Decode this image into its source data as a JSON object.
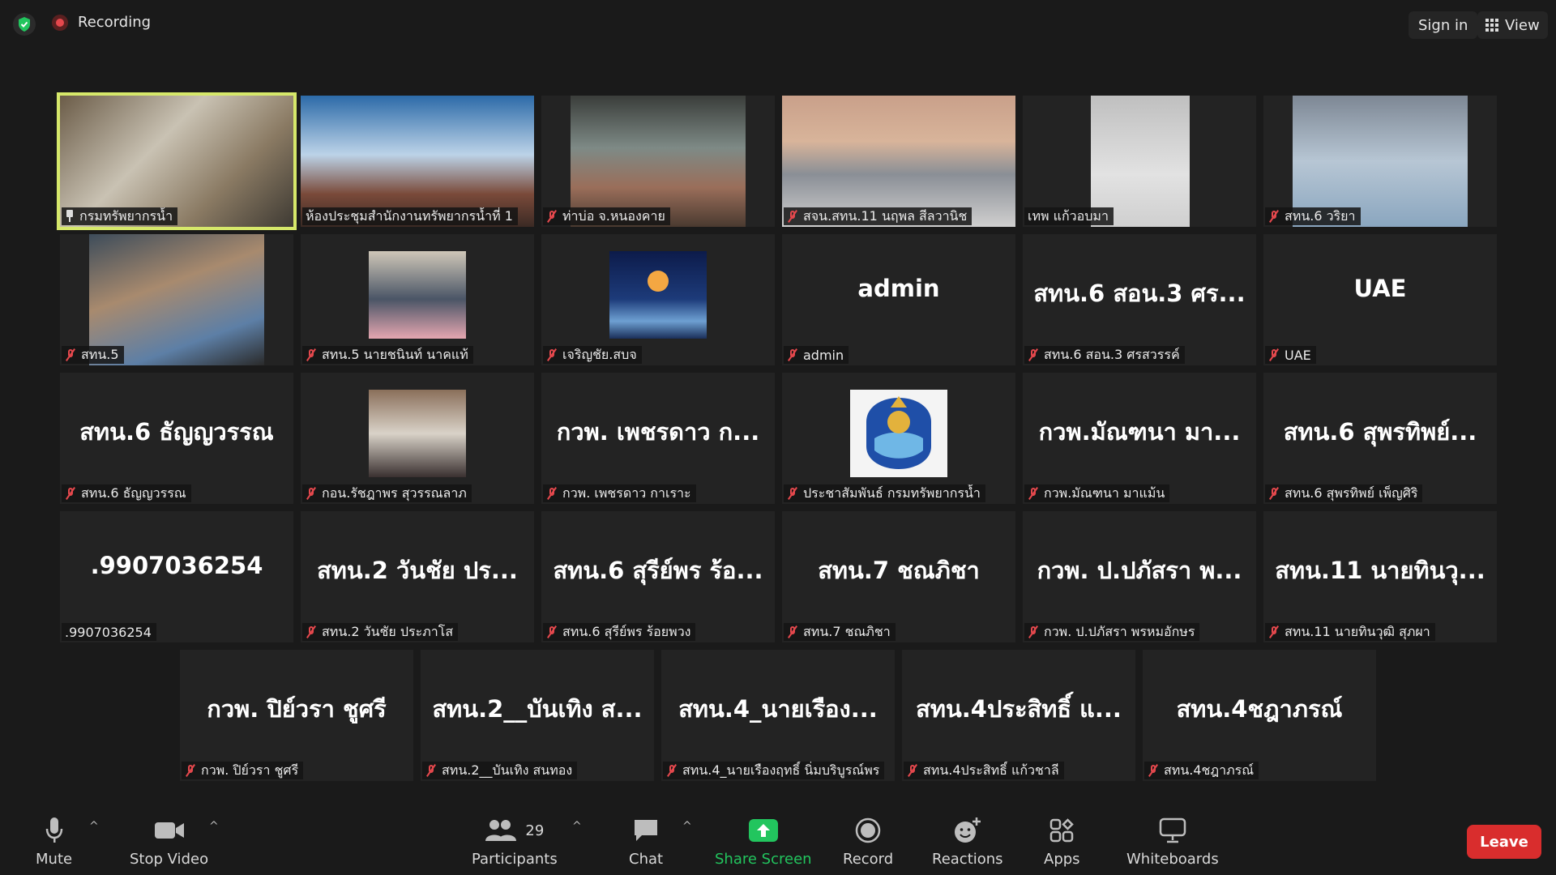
{
  "top": {
    "recording_label": "Recording",
    "sign_in": "Sign in",
    "view": "View"
  },
  "tiles": [
    {
      "label": "กรมทรัพยากรน้ำ",
      "big": "",
      "muted": false,
      "pinned": true
    },
    {
      "label": "ห้องประชุมสำนักงานทรัพยากรน้ำที่ 1",
      "big": "",
      "muted": false
    },
    {
      "label": "ท่าบ่อ จ.หนองคาย",
      "big": "",
      "muted": true
    },
    {
      "label": "สจน.สทน.11 นฤพล สีลวานิช",
      "big": "",
      "muted": true
    },
    {
      "label": "เทพ แก้วอบมา",
      "big": "",
      "muted": false
    },
    {
      "label": "สทน.6 วริยา",
      "big": "",
      "muted": true
    },
    {
      "label": "สทน.5",
      "big": "",
      "muted": true
    },
    {
      "label": "สทน.5 นายชนินท์ นาคแท้",
      "big": "",
      "muted": true
    },
    {
      "label": "เจริญชัย.สบจ",
      "big": "",
      "muted": true
    },
    {
      "label": "admin",
      "big": "admin",
      "muted": true
    },
    {
      "label": "สทน.6 สอน.3 ศรสวรรค์",
      "big": "สทน.6 สอน.3 ศร...",
      "muted": true
    },
    {
      "label": "UAE",
      "big": "UAE",
      "muted": true
    },
    {
      "label": "สทน.6 ธัญญวรรณ",
      "big": "สทน.6 ธัญญวรรณ",
      "muted": true
    },
    {
      "label": "กอน.รัชฎาพร สุวรรณลาภ",
      "big": "",
      "muted": true
    },
    {
      "label": "กวพ. เพชรดาว กาเราะ",
      "big": "กวพ. เพชรดาว ก...",
      "muted": true
    },
    {
      "label": "ประชาสัมพันธ์ กรมทรัพยากรน้ำ",
      "big": "",
      "muted": true
    },
    {
      "label": "กวพ.มัณฑนา มาแม้น",
      "big": "กวพ.มัณฑนา มา...",
      "muted": true
    },
    {
      "label": "สทน.6 สุพรทิพย์ เพ็ญศิริ",
      "big": "สทน.6 สุพรทิพย์...",
      "muted": true
    },
    {
      "label": ".9907036254",
      "big": ".9907036254",
      "muted": false
    },
    {
      "label": "สทน.2 วันชัย ประภาโส",
      "big": "สทน.2 วันชัย ปร...",
      "muted": true
    },
    {
      "label": "สทน.6 สุรีย์พร ร้อยพวง",
      "big": "สทน.6 สุรีย์พร ร้อ...",
      "muted": true
    },
    {
      "label": "สทน.7 ชณภิชา",
      "big": "สทน.7 ชณภิชา",
      "muted": true
    },
    {
      "label": "กวพ. ป.ปภัสรา พรหมอักษร",
      "big": "กวพ. ป.ปภัสรา พ...",
      "muted": true
    },
    {
      "label": "สทน.11 นายทินวุฒิ สุภผา",
      "big": "สทน.11 นายทินวุ...",
      "muted": true
    },
    {
      "label": "กวพ. ปิย์วรา ชูศรี",
      "big": "กวพ. ปิย์วรา ชูศรี",
      "muted": true
    },
    {
      "label": "สทน.2__บันเทิง สนทอง",
      "big": "สทน.2__บันเทิง ส...",
      "muted": true
    },
    {
      "label": "สทน.4_นายเรืองฤทธิ์ นิ่มบริบูรณ์พร",
      "big": "สทน.4_นายเรือง...",
      "muted": true
    },
    {
      "label": "สทน.4ประสิทธิ์ แก้วชาลี",
      "big": "สทน.4ประสิทธิ์ แ...",
      "muted": true
    },
    {
      "label": "สทน.4ชฎาภรณ์",
      "big": "สทน.4ชฎาภรณ์",
      "muted": true
    }
  ],
  "toolbar": {
    "mute": "Mute",
    "stop_video": "Stop Video",
    "participants": "Participants",
    "participants_count": "29",
    "chat": "Chat",
    "share_screen": "Share Screen",
    "record": "Record",
    "reactions": "Reactions",
    "apps": "Apps",
    "whiteboards": "Whiteboards",
    "leave": "Leave"
  },
  "colors": {
    "accent_green": "#22c55e",
    "active_speaker": "#d6e86a",
    "leave_red": "#d92d2d",
    "muted_red": "#e5484d"
  }
}
